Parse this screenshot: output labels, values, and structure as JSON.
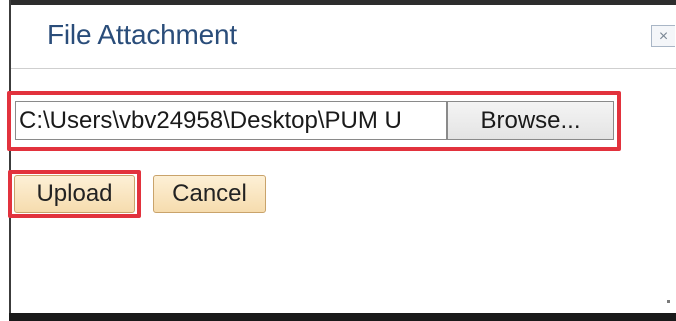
{
  "dialog": {
    "title": "File Attachment",
    "close_label": "×"
  },
  "file_input": {
    "value": "C:\\Users\\vbv24958\\Desktop\\PUM U"
  },
  "buttons": {
    "browse_label": "Browse...",
    "upload_label": "Upload",
    "cancel_label": "Cancel"
  },
  "colors": {
    "title_text": "#2a4d7a",
    "highlight_border": "#e2323d",
    "button_fill": "#f6dcae",
    "button_border": "#c9a36b"
  }
}
